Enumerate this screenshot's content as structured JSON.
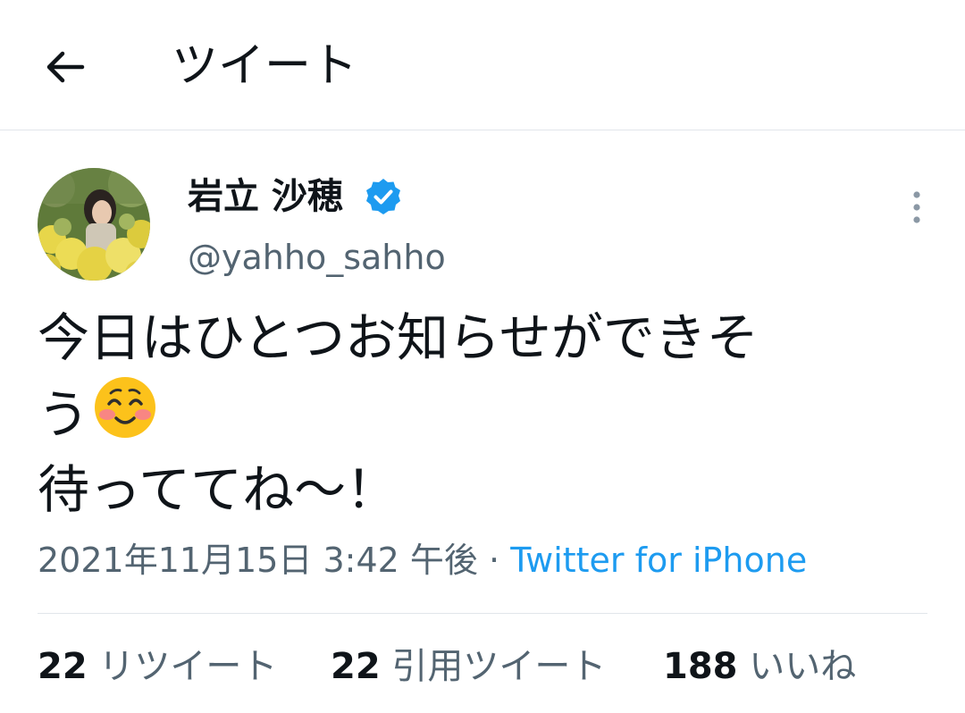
{
  "header": {
    "title": "ツイート",
    "back_icon": "arrow-left-icon"
  },
  "author": {
    "display_name": "岩立 沙穂",
    "handle": "@yahho_sahho",
    "verified": true,
    "verified_color": "#1d9bf0"
  },
  "tweet": {
    "lines": [
      "今日はひとつお知らせができそ",
      "う",
      "待っててね〜！"
    ],
    "emoji": "smiling-face-with-smiling-eyes"
  },
  "meta": {
    "timestamp": "2021年11月15日 3:42 午後",
    "separator": "·",
    "source": "Twitter for iPhone"
  },
  "stats": {
    "retweets_count": "22",
    "retweets_label": "リツイート",
    "quotes_count": "22",
    "quotes_label": "引用ツイート",
    "likes_count": "188",
    "likes_label": "いいね"
  },
  "colors": {
    "accent": "#1d9bf0",
    "text": "#0f1419",
    "secondary_text": "#536471",
    "divider": "#e1e6ea"
  }
}
